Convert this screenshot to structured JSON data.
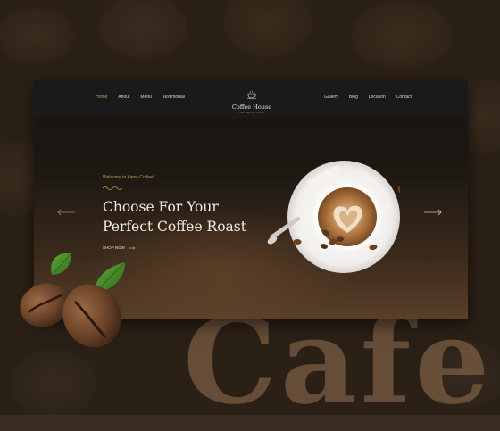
{
  "nav": {
    "left_items": [
      "Home",
      "About",
      "Menu",
      "Testimonial"
    ],
    "right_items": [
      "Gallery",
      "Blog",
      "Location",
      "Contact"
    ],
    "logo_title": "Coffee House",
    "logo_tagline": "THE BEANS SHOP"
  },
  "hero": {
    "welcome": "Welcome to Alpsa Coffee!",
    "headline_line1": "Choose For Your",
    "headline_line2": "Perfect Coffee Roast",
    "cta": "SHOP NOW"
  },
  "background_word": "Cafe",
  "colors": {
    "accent": "#c89a5c",
    "nav_bg": "#1b1a1a",
    "text_light": "#f2ece4"
  },
  "icons": [
    "coffee-cup-icon",
    "arrow-left-icon",
    "arrow-right-icon",
    "arrow-icon"
  ]
}
